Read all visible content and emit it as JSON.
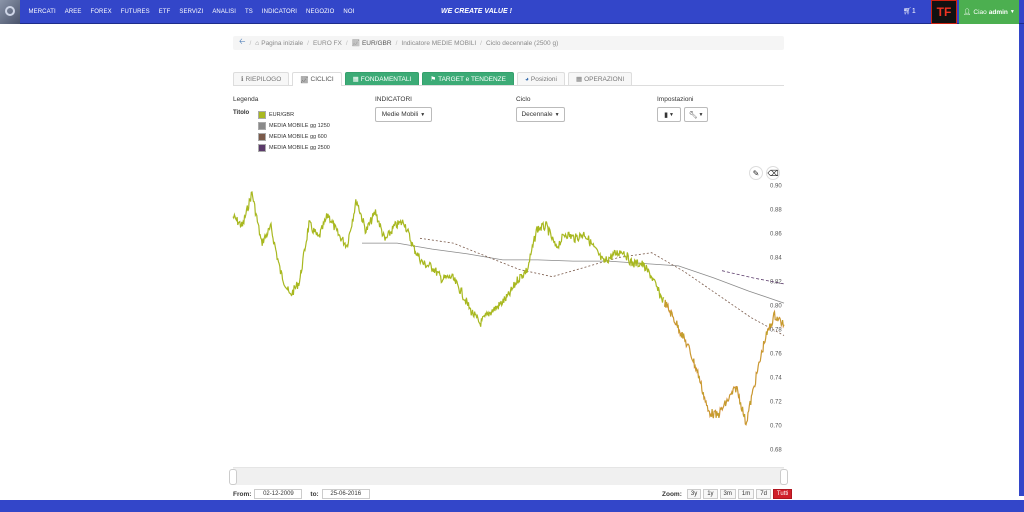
{
  "nav": {
    "items": [
      "MERCATI",
      "AREE",
      "FOREX",
      "FUTURES",
      "ETF",
      "SERVIZI",
      "ANALISI",
      "TS",
      "INDICATORI",
      "NEGOZIO",
      "NOI"
    ],
    "slogan": "WE CREATE VALUE !",
    "cart_count": "1",
    "user_greeting": "Ciao",
    "user_name": "admin",
    "logo_text": "TF"
  },
  "breadcrumb": [
    "Pagina iniziale",
    "EURO FX",
    "EUR/GBR",
    "Indicatore MEDIE MOBILI",
    "Ciclo decennale (2500 g)"
  ],
  "tabs": [
    {
      "label": "RIEPILOGO",
      "icon": "info-icon"
    },
    {
      "label": "CICLICI",
      "icon": "chart-icon"
    },
    {
      "label": "FONDAMENTALI",
      "icon": "table-icon"
    },
    {
      "label": "TARGET e TENDENZE",
      "icon": "flag-icon"
    },
    {
      "label": "Posizioni",
      "icon": "pie-icon"
    },
    {
      "label": "OPERAZIONI",
      "icon": "calc-icon"
    }
  ],
  "controls": {
    "legenda_label": "Legenda",
    "titolo_label": "Titolo",
    "indicatori_label": "INDICATORI",
    "indicatori_value": "Medie Mobili",
    "ciclo_label": "Ciclo",
    "ciclo_value": "Decennale",
    "impostazioni_label": "Impostazioni"
  },
  "legend": [
    {
      "label": "EUR/GBR",
      "color": "#a8b820"
    },
    {
      "label": "MEDIA MOBILE gg 1250",
      "color": "#8a8a8a"
    },
    {
      "label": "MEDIA MOBILE gg 600",
      "color": "#7a5a4a"
    },
    {
      "label": "MEDIA MOBILE gg 2500",
      "color": "#5a3a6a"
    }
  ],
  "chart_data": {
    "type": "line",
    "ylim": [
      0.68,
      0.91
    ],
    "y_ticks": [
      "0.90",
      "0.88",
      "0.86",
      "0.84",
      "0.82",
      "0.80",
      "0.78",
      "0.76",
      "0.74",
      "0.72",
      "0.70",
      "0.68"
    ],
    "series": [
      {
        "name": "EUR/GBR",
        "color": "#a8b820",
        "color_late": "#d98a3a",
        "y": [
          0.874,
          0.866,
          0.894,
          0.852,
          0.865,
          0.828,
          0.808,
          0.82,
          0.868,
          0.856,
          0.876,
          0.86,
          0.85,
          0.888,
          0.862,
          0.878,
          0.854,
          0.866,
          0.87,
          0.848,
          0.835,
          0.832,
          0.822,
          0.824,
          0.812,
          0.796,
          0.785,
          0.794,
          0.8,
          0.808,
          0.822,
          0.83,
          0.864,
          0.866,
          0.848,
          0.86,
          0.856,
          0.86,
          0.848,
          0.836,
          0.842,
          0.846,
          0.835,
          0.835,
          0.825,
          0.808,
          0.795,
          0.78,
          0.764,
          0.742,
          0.712,
          0.708,
          0.72,
          0.732,
          0.702,
          0.738,
          0.772,
          0.792,
          0.784
        ]
      },
      {
        "name": "MEDIA MOBILE gg 1250",
        "color": "#8a8a8a",
        "y": [
          0.852,
          0.852,
          0.847,
          0.843,
          0.838,
          0.838,
          0.837,
          0.837,
          0.835,
          0.833,
          0.823,
          0.812,
          0.802
        ]
      },
      {
        "name": "MEDIA MOBILE gg 600",
        "color": "#7a5a4a",
        "y": [
          0.856,
          0.852,
          0.841,
          0.83,
          0.824,
          0.832,
          0.84,
          0.844,
          0.828,
          0.809,
          0.79,
          0.775
        ]
      },
      {
        "name": "MEDIA MOBILE gg 2500",
        "color": "#5a3a6a",
        "y": [
          0.829,
          0.823,
          0.818
        ]
      }
    ]
  },
  "range": {
    "from_label": "From:",
    "from_value": "02-12-2009",
    "to_label": "to:",
    "to_value": "25-06-2016"
  },
  "zoom": {
    "label": "Zoom:",
    "buttons": [
      "3y",
      "1y",
      "3m",
      "1m",
      "7d",
      "Tutti"
    ],
    "active": "Tutti"
  }
}
